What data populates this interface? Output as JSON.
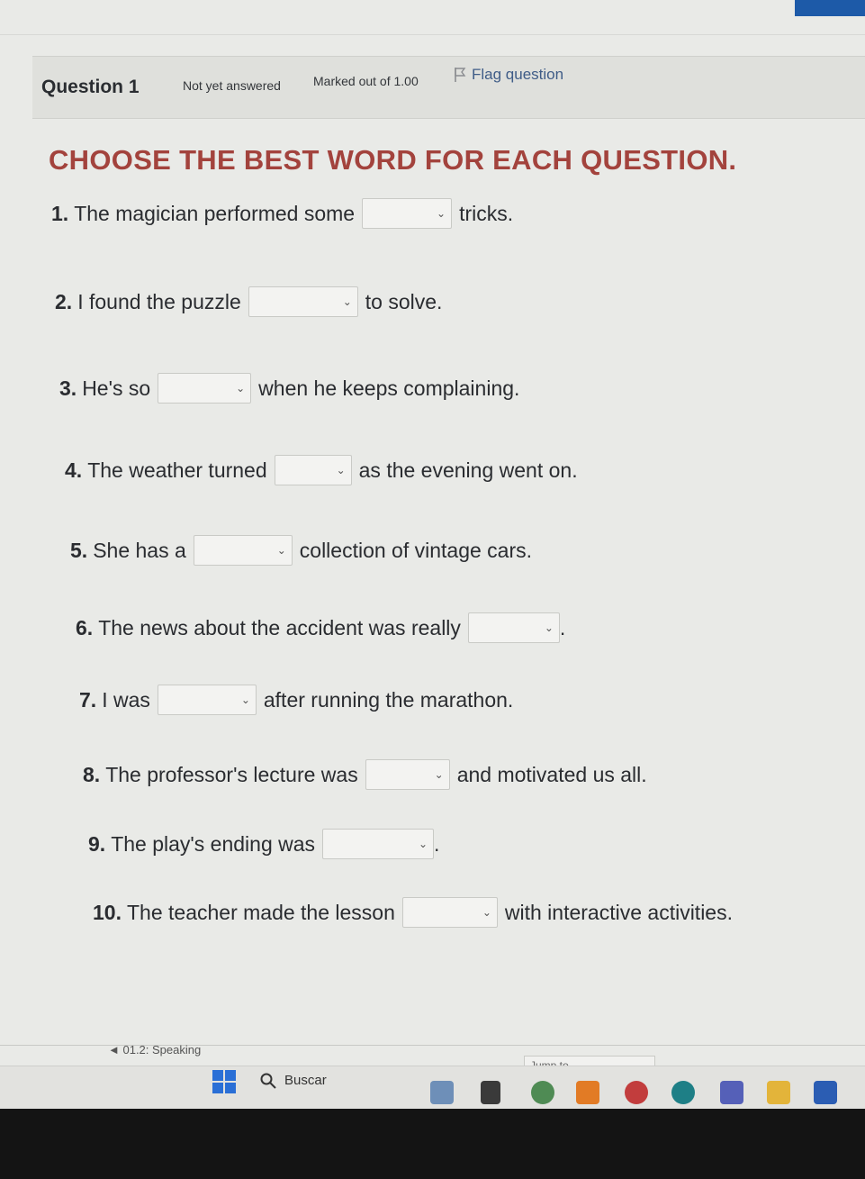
{
  "question_info": {
    "number": "Question 1",
    "state": "Not yet answered",
    "grade": "Marked out of 1.00",
    "flag": "Flag question"
  },
  "heading": "CHOOSE THE BEST WORD FOR EACH QUESTION.",
  "questions": [
    {
      "num": "1.",
      "before": "The magician performed some",
      "after": "tricks.",
      "selected": ""
    },
    {
      "num": "2.",
      "before": "I found the puzzle",
      "after": "to solve.",
      "selected": ""
    },
    {
      "num": "3.",
      "before": "He's so",
      "after": "when he keeps complaining.",
      "selected": ""
    },
    {
      "num": "4.",
      "before": "The weather turned",
      "after": "as the evening went on.",
      "selected": ""
    },
    {
      "num": "5.",
      "before": "She has a",
      "after": "collection of vintage cars.",
      "selected": ""
    },
    {
      "num": "6.",
      "before": "The news about the accident was really",
      "after": ".",
      "selected": ""
    },
    {
      "num": "7.",
      "before": "I was",
      "after": "after running the marathon.",
      "selected": ""
    },
    {
      "num": "8.",
      "before": "The professor's lecture was",
      "after": "and motivated us all.",
      "selected": ""
    },
    {
      "num": "9.",
      "before": "The play's ending was",
      "after": ".",
      "selected": ""
    },
    {
      "num": "10.",
      "before": "The teacher made the lesson",
      "after": "with interactive activities.",
      "selected": ""
    }
  ],
  "navigation": {
    "previous": "◄ 01.2: Speaking",
    "jump_to": "Jump to..."
  },
  "taskbar": {
    "search_label": "Buscar"
  },
  "colors": {
    "heading": "#a3433d",
    "flag": "#3f5c87",
    "accent": "#1d5aa8"
  }
}
